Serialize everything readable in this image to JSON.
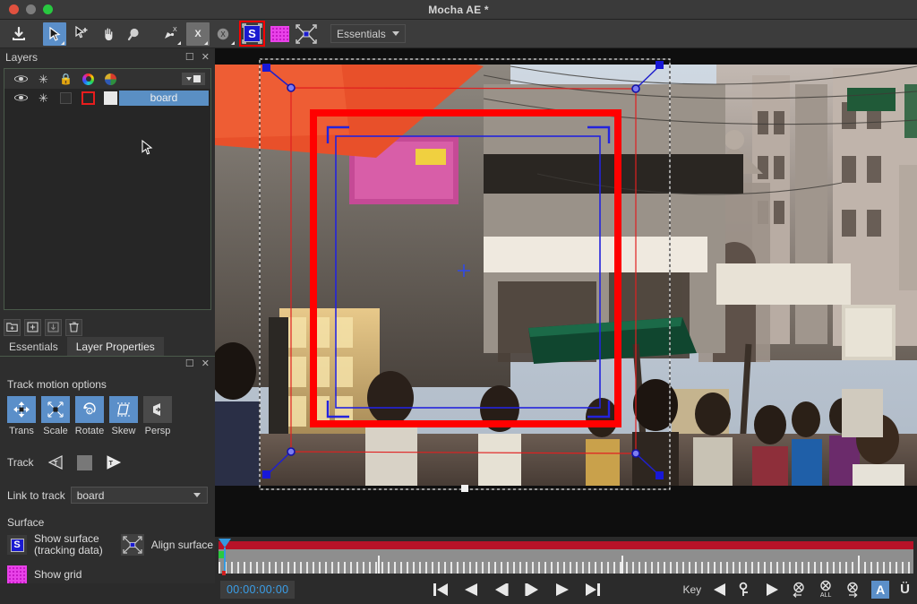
{
  "window": {
    "title": "Mocha AE *"
  },
  "toolbar": {
    "tools": [
      {
        "name": "export-icon",
        "label": "Export"
      },
      {
        "name": "select-tool",
        "label": "Select"
      },
      {
        "name": "add-point-tool",
        "label": "Add Point"
      },
      {
        "name": "pan-tool",
        "label": "Pan"
      },
      {
        "name": "zoom-tool",
        "label": "Zoom"
      },
      {
        "name": "pen-tool",
        "label": "Pen X"
      },
      {
        "name": "xspline-tool",
        "label": "X-Spline"
      },
      {
        "name": "bezier-tool",
        "label": "Bezier X"
      },
      {
        "name": "show-surface-tool",
        "label": "S"
      },
      {
        "name": "show-grid-tool",
        "label": "Grid"
      },
      {
        "name": "align-surface-tool",
        "label": "Align Surface"
      }
    ],
    "workspace": {
      "label": "Essentials"
    }
  },
  "layers_panel": {
    "title": "Layers",
    "header_icons": [
      "eye-icon",
      "gear-icon",
      "lock-icon",
      "color-ring-icon",
      "color-pie-icon"
    ],
    "rows": [
      {
        "name": "board",
        "visible": true,
        "gear": true,
        "locked": false,
        "outline_color": "#e71d1d",
        "fill_color": "#e8e8e8",
        "selected": true
      }
    ],
    "footer_buttons": [
      "new-folder-icon",
      "add-layer-icon",
      "import-layer-icon",
      "delete-layer-icon"
    ]
  },
  "tabs": [
    {
      "label": "Essentials",
      "active": false
    },
    {
      "label": "Layer Properties",
      "active": true
    }
  ],
  "properties": {
    "track_motion": {
      "title": "Track motion options",
      "options": [
        {
          "label": "Trans",
          "icon": "translate-icon",
          "active": true
        },
        {
          "label": "Scale",
          "icon": "scale-icon",
          "active": true
        },
        {
          "label": "Rotate",
          "icon": "rotate-icon",
          "active": true
        },
        {
          "label": "Skew",
          "icon": "skew-icon",
          "active": true
        },
        {
          "label": "Persp",
          "icon": "perspective-icon",
          "active": false
        }
      ]
    },
    "track": {
      "label": "Track",
      "back_icon": "track-backwards-icon",
      "stop_icon": "track-stop-icon",
      "forward_icon": "track-forwards-icon"
    },
    "link": {
      "label": "Link to track",
      "value": "board"
    },
    "surface": {
      "title": "Surface",
      "show_surface_label": "Show surface\n(tracking data)",
      "show_surface_line1": "Show surface",
      "show_surface_line2": "(tracking data)",
      "align_surface_label": "Align surface",
      "show_grid_label": "Show grid"
    }
  },
  "timeline": {
    "timecode": "00:00:00:00",
    "clip_color": "#b81228",
    "playhead_position_frames": 0,
    "transport": [
      {
        "name": "go-to-start-button",
        "glyph": "first-frame"
      },
      {
        "name": "play-backward-button",
        "glyph": "play-back"
      },
      {
        "name": "step-back-button",
        "glyph": "step-back"
      },
      {
        "name": "step-forward-button",
        "glyph": "step-fwd"
      },
      {
        "name": "play-forward-button",
        "glyph": "play-fwd"
      },
      {
        "name": "go-to-end-button",
        "glyph": "last-frame"
      }
    ],
    "key_controls": {
      "label": "Key",
      "prev_key": "prev-keyframe-button",
      "add_key": "add-keyframe-button",
      "next_key": "next-keyframe-button",
      "del_prev": "delete-keys-before-button",
      "del_all": "delete-all-keys-button",
      "del_all_label": "ALL",
      "del_next": "delete-keys-after-button",
      "auto_key": "A",
      "u_button": "Ü"
    }
  },
  "viewport": {
    "overlays": {
      "spline_color": "#ff0000",
      "surface_color": "#2222dd",
      "bbox_color": "#d8d8d8",
      "handle_color": "#1212cc"
    }
  }
}
